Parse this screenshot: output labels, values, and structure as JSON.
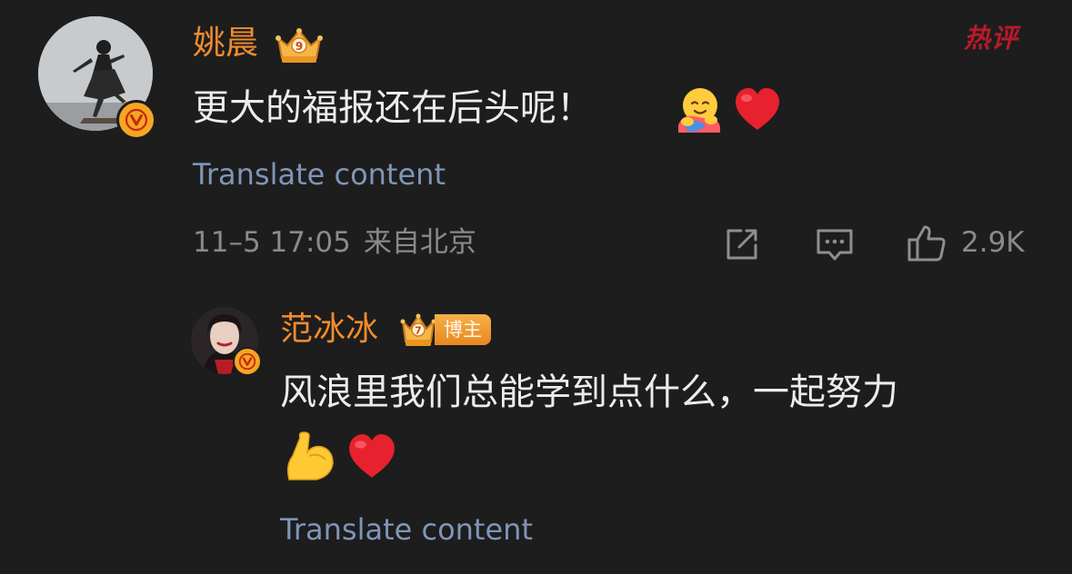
{
  "main_comment": {
    "username": "姚晨",
    "crown_level": "9",
    "hot_tag": "热评",
    "text": "更大的福报还在后头呢！",
    "emojis": [
      "hugging-face-emoji",
      "red-heart-emoji"
    ],
    "translate_label": "Translate content",
    "timestamp": "11–5 17:05",
    "location": "来自北京",
    "like_count": "2.9K"
  },
  "reply": {
    "username": "范冰冰",
    "crown_level": "7",
    "role_tag": "博主",
    "text": "风浪里我们总能学到点什么，一起努力",
    "emojis": [
      "flexed-biceps-emoji",
      "red-heart-emoji"
    ],
    "translate_label": "Translate content"
  },
  "colors": {
    "background": "#1d1d1d",
    "username": "#f08c2e",
    "translate_link": "#7f95b8",
    "meta_text": "#8a8a8a",
    "hot_tag": "#b81a2a",
    "verified_badge": "#f5a623"
  },
  "icons": {
    "share": "share-icon",
    "comment": "comment-icon",
    "like": "thumbs-up-icon",
    "verified": "verified-v-icon",
    "crown": "crown-icon"
  }
}
